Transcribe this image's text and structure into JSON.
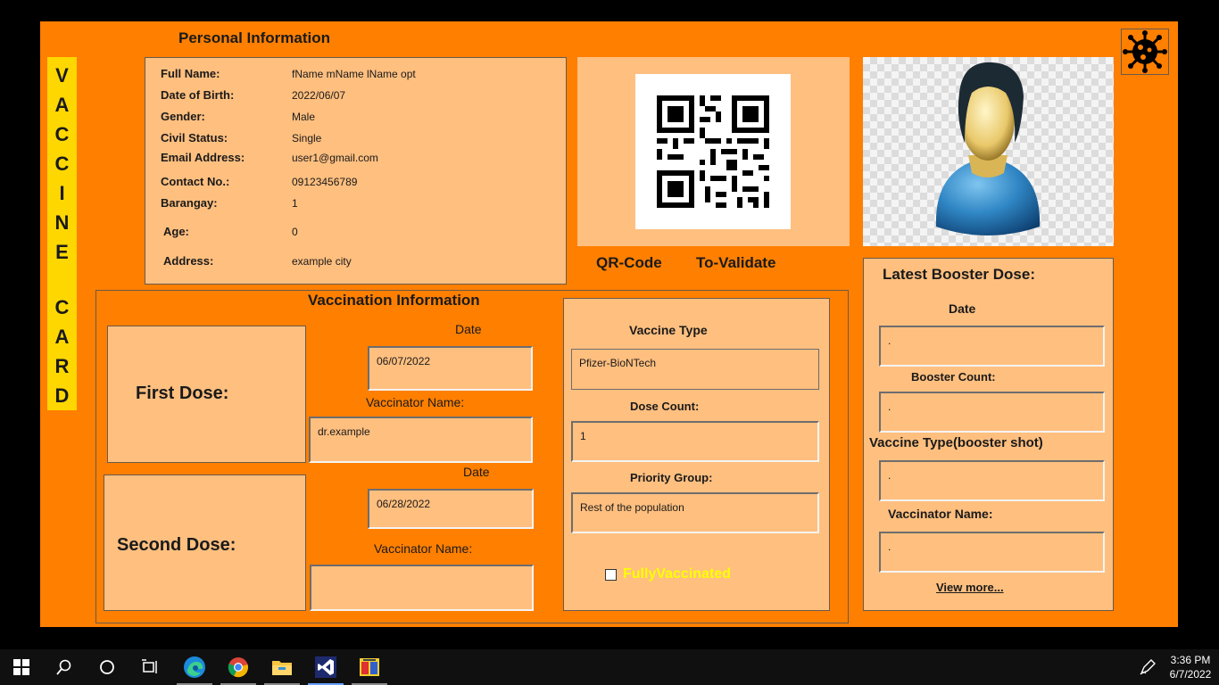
{
  "card_title_letters": [
    "V",
    "A",
    "C",
    "C",
    "I",
    "N",
    "E",
    "",
    "C",
    "A",
    "R",
    "D"
  ],
  "personal": {
    "title": "Personal Information",
    "rows": [
      {
        "label": "Full Name:",
        "value": "fName mName lName opt"
      },
      {
        "label": "Date of Birth:",
        "value": "2022/06/07"
      },
      {
        "label": "Gender:",
        "value": "Male"
      },
      {
        "label": "Civil Status:",
        "value": "Single"
      },
      {
        "label": "Email Address:",
        "value": "user1@gmail.com"
      },
      {
        "label": "Contact No.:",
        "value": "09123456789"
      },
      {
        "label": "Barangay:",
        "value": "1"
      },
      {
        "label": "Age:",
        "value": "0"
      },
      {
        "label": "Address:",
        "value": "example city"
      }
    ]
  },
  "qr": {
    "label": "QR-Code",
    "validate_label": "To-Validate"
  },
  "vaccination": {
    "title": "Vaccination Information",
    "first_dose_label": "First Dose:",
    "second_dose_label": "Second Dose:",
    "date_label": "Date",
    "vaccinator_label": "Vaccinator Name:",
    "first_date": "06/07/2022",
    "first_vaccinator": "dr.example",
    "second_date": "06/28/2022",
    "second_vaccinator": "",
    "vaccine_type_label": "Vaccine Type",
    "vaccine_type": "Pfizer-BioNTech",
    "dose_count_label": "Dose Count:",
    "dose_count": "1",
    "priority_label": "Priority Group:",
    "priority": "Rest of the population",
    "fully_vaccinated_label": "FullyVaccinated",
    "fully_vaccinated_checked": false
  },
  "booster": {
    "title": "Latest Booster Dose:",
    "date_label": "Date",
    "date": ".",
    "count_label": "Booster Count:",
    "count": ".",
    "type_label": "Vaccine Type(booster shot)",
    "type": ".",
    "vaccinator_label": "Vaccinator Name:",
    "vaccinator": ".",
    "view_more": "View more..."
  },
  "taskbar": {
    "time": "3:36 PM",
    "date": "6/7/2022",
    "icons": [
      "windows-start-icon",
      "search-icon",
      "cortana-icon",
      "task-view-icon",
      "edge-icon",
      "chrome-icon",
      "file-explorer-icon",
      "visual-studio-icon",
      "app-icon"
    ]
  },
  "colors": {
    "form_bg": "#FF7F00",
    "panel_bg": "#FFBF7F",
    "title_bg": "#FFD700",
    "fully_vaccinated": "#FFFF00"
  }
}
